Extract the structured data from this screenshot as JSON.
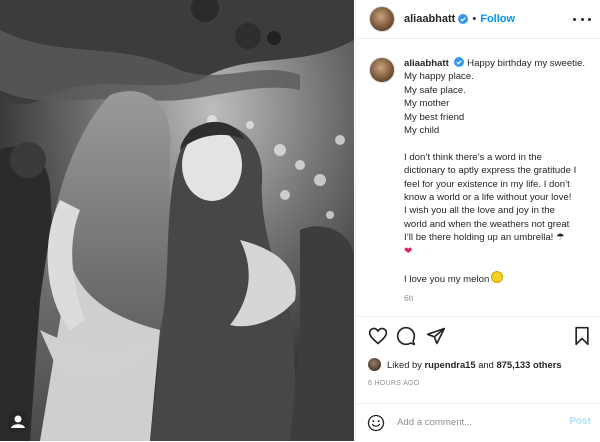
{
  "post": {
    "username": "aliaabhatt",
    "follow_label": "Follow",
    "separator": "•",
    "verified_icon": "verified-badge-icon",
    "more_icon": "more-options-icon"
  },
  "caption": {
    "lines": [
      "Happy birthday my sweetie.",
      "My happy place.",
      "My safe place.",
      "My mother",
      "My best friend",
      "My child",
      "",
      "I don’t think there’s a word in the",
      "dictionary to aptly express the gratitude I",
      "feel for your existence in my life. I don’t",
      "know a world or a life without your love!",
      "I wish you all the love and joy in the",
      "world and when the weathers not great",
      "I’ll be there holding up an umbrella! ☂",
      "❤",
      "",
      "I love you my melon"
    ],
    "time": "6h"
  },
  "actions": {
    "like_icon": "heart-outline-icon",
    "comment_icon": "comment-icon",
    "share_icon": "paper-plane-icon",
    "save_icon": "bookmark-icon"
  },
  "likes": {
    "prefix": "Liked by",
    "user": "rupendra15",
    "and": "and",
    "count": "875,133 others"
  },
  "posted_ago": "6 HOURS AGO",
  "comment_box": {
    "placeholder": "Add a comment...",
    "post_label": "Post",
    "emoji_icon": "smiley-icon"
  },
  "colors": {
    "accent": "#0095f6",
    "post_disabled": "#b2dffc",
    "text": "#262626",
    "muted": "#8e8e8e"
  }
}
